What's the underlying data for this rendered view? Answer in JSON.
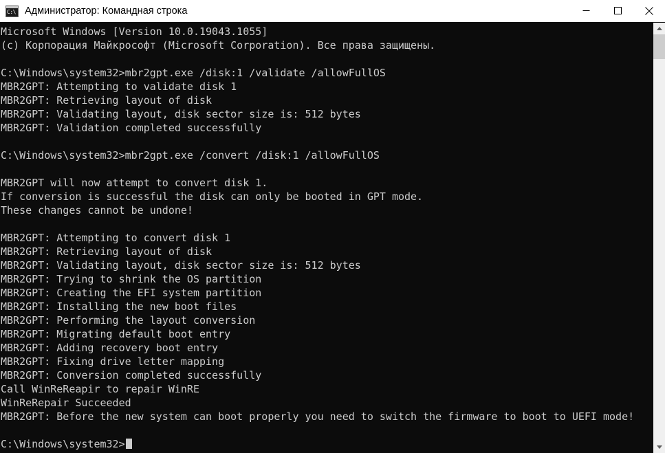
{
  "window": {
    "title": "Администратор: Командная строка",
    "icon": "command-prompt-icon",
    "colors": {
      "titlebar_bg": "#ffffff",
      "titlebar_fg": "#000000",
      "console_bg": "#0c0c0c",
      "console_fg": "#cccccc",
      "scrollbar_track": "#f0f0f0",
      "scrollbar_thumb": "#cdcdcd"
    },
    "controls": {
      "minimize_label": "—",
      "maximize_label": "□",
      "close_label": "✕"
    }
  },
  "scrollbar": {
    "up_arrow": "scroll-up-arrow",
    "down_arrow": "scroll-down-arrow",
    "thumb": "scroll-thumb"
  },
  "console": {
    "prompt": "C:\\Windows\\system32>",
    "cursor": "block",
    "lines": [
      "Microsoft Windows [Version 10.0.19043.1055]",
      "(c) Корпорация Майкрософт (Microsoft Corporation). Все права защищены.",
      "",
      "C:\\Windows\\system32>mbr2gpt.exe /disk:1 /validate /allowFullOS",
      "MBR2GPT: Attempting to validate disk 1",
      "MBR2GPT: Retrieving layout of disk",
      "MBR2GPT: Validating layout, disk sector size is: 512 bytes",
      "MBR2GPT: Validation completed successfully",
      "",
      "C:\\Windows\\system32>mbr2gpt.exe /convert /disk:1 /allowFullOS",
      "",
      "MBR2GPT will now attempt to convert disk 1.",
      "If conversion is successful the disk can only be booted in GPT mode.",
      "These changes cannot be undone!",
      "",
      "MBR2GPT: Attempting to convert disk 1",
      "MBR2GPT: Retrieving layout of disk",
      "MBR2GPT: Validating layout, disk sector size is: 512 bytes",
      "MBR2GPT: Trying to shrink the OS partition",
      "MBR2GPT: Creating the EFI system partition",
      "MBR2GPT: Installing the new boot files",
      "MBR2GPT: Performing the layout conversion",
      "MBR2GPT: Migrating default boot entry",
      "MBR2GPT: Adding recovery boot entry",
      "MBR2GPT: Fixing drive letter mapping",
      "MBR2GPT: Conversion completed successfully",
      "Call WinReReapir to repair WinRE",
      "WinReRepair Succeeded",
      "MBR2GPT: Before the new system can boot properly you need to switch the firmware to boot to UEFI mode!",
      ""
    ],
    "last_line": "C:\\Windows\\system32>"
  }
}
